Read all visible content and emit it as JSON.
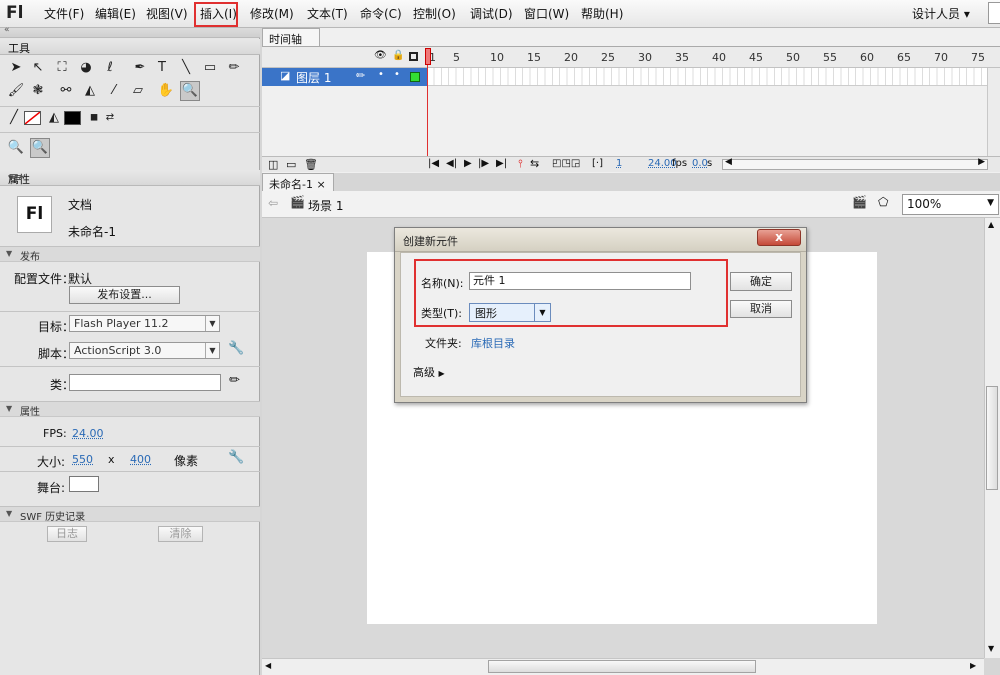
{
  "app": {
    "logo": "Fl"
  },
  "menu": [
    "文件(F)",
    "编辑(E)",
    "视图(V)",
    "插入(I)",
    "修改(M)",
    "文本(T)",
    "命令(C)",
    "控制(O)",
    "调试(D)",
    "窗口(W)",
    "帮助(H)"
  ],
  "workspace": "设计人员",
  "tools_panel": {
    "title": "工具"
  },
  "properties_panel": {
    "title": "属性",
    "doc_icon": "Fl",
    "doc_type": "文档",
    "doc_name": "未命名-1",
    "publish": {
      "section": "发布",
      "profile_label": "配置文件：",
      "profile_value": "默认",
      "settings_button": "发布设置...",
      "target_label": "目标：",
      "target_value": "Flash Player 11.2",
      "script_label": "脚本：",
      "script_value": "ActionScript 3.0",
      "class_label": "类："
    },
    "props": {
      "section": "属性",
      "fps_label": "FPS:",
      "fps_value": "24.00",
      "size_label": "大小:",
      "width": "550",
      "times": "x",
      "height": "400",
      "unit": "像素",
      "stage_label": "舞台:",
      "stage_color": "#ffffff"
    },
    "swf": {
      "section": "SWF 历史记录",
      "log_button": "日志",
      "clear_button": "清除"
    }
  },
  "timeline": {
    "tab": "时间轴",
    "layer_name": "图层 1",
    "frame_numbers": [
      "1",
      "5",
      "10",
      "15",
      "20",
      "25",
      "30",
      "35",
      "40",
      "45",
      "50",
      "55",
      "60",
      "65",
      "70",
      "75"
    ],
    "current_frame": "1",
    "fps": "24.00",
    "fps_unit": "fps",
    "time": "0.0",
    "time_unit": "s"
  },
  "document": {
    "tab": "未命名-1",
    "close": "×",
    "scene": "场景 1",
    "zoom": "100%"
  },
  "dialog": {
    "title": "创建新元件",
    "close": "x",
    "name_label": "名称(N):",
    "name_value": "元件 1",
    "type_label": "类型(T):",
    "type_value": "图形",
    "ok_button": "确定",
    "cancel_button": "取消",
    "folder_label": "文件夹:",
    "folder_value": "库根目录",
    "advanced_label": "高级"
  },
  "colors": {
    "highlight": "#e03030",
    "layer_selected": "#3a74c8",
    "link": "#2a6ab6"
  }
}
